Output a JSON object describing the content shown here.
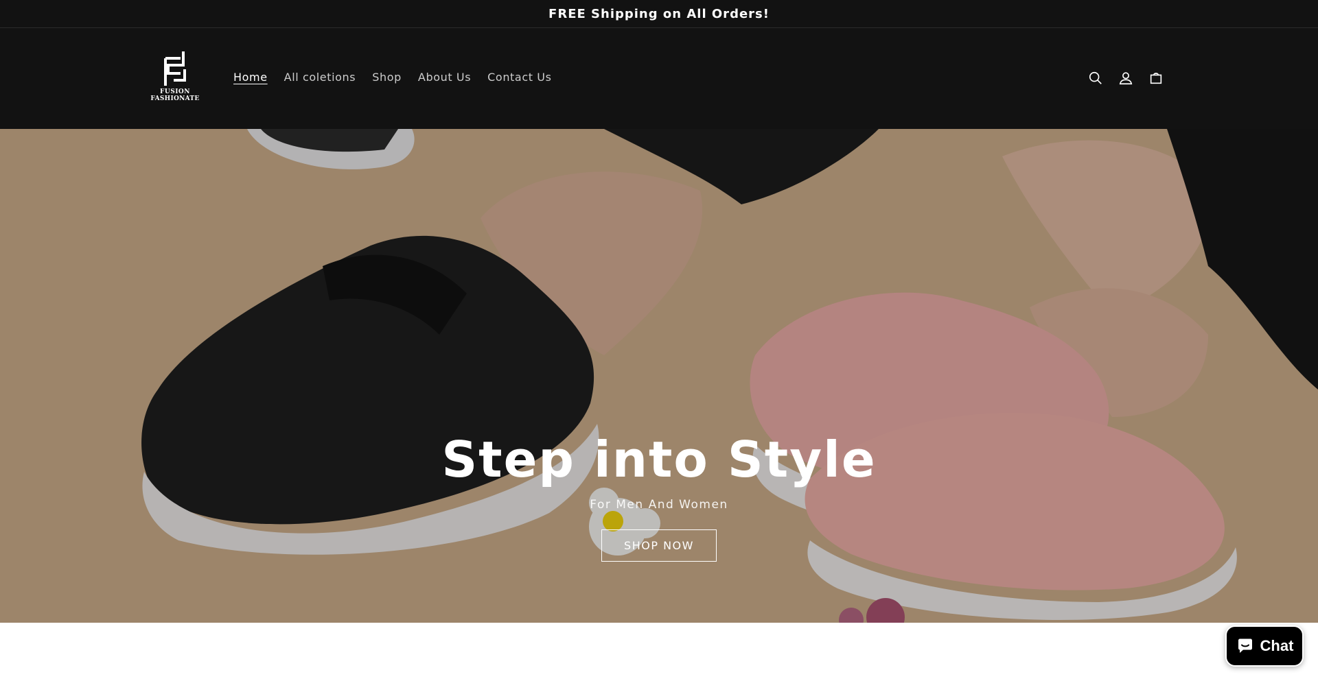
{
  "announcement": {
    "text": "FREE Shipping on All Orders!"
  },
  "brand": {
    "line1": "FUSION",
    "line2": "FASHIONATE"
  },
  "nav": {
    "items": [
      {
        "label": "Home",
        "active": true
      },
      {
        "label": "All coletions",
        "active": false
      },
      {
        "label": "Shop",
        "active": false
      },
      {
        "label": "About Us",
        "active": false
      },
      {
        "label": "Contact Us",
        "active": false
      }
    ]
  },
  "header_icons": [
    "search-icon",
    "account-icon",
    "cart-icon"
  ],
  "hero": {
    "title": "Step into Style",
    "subtitle": "For Men And Women",
    "button_label": "SHOP NOW"
  },
  "chat": {
    "label": "Chat",
    "icon": "chat-bubble-icon"
  },
  "colors": {
    "header_bg": "#121212",
    "text": "#ffffff",
    "chat_bg": "#000000"
  }
}
